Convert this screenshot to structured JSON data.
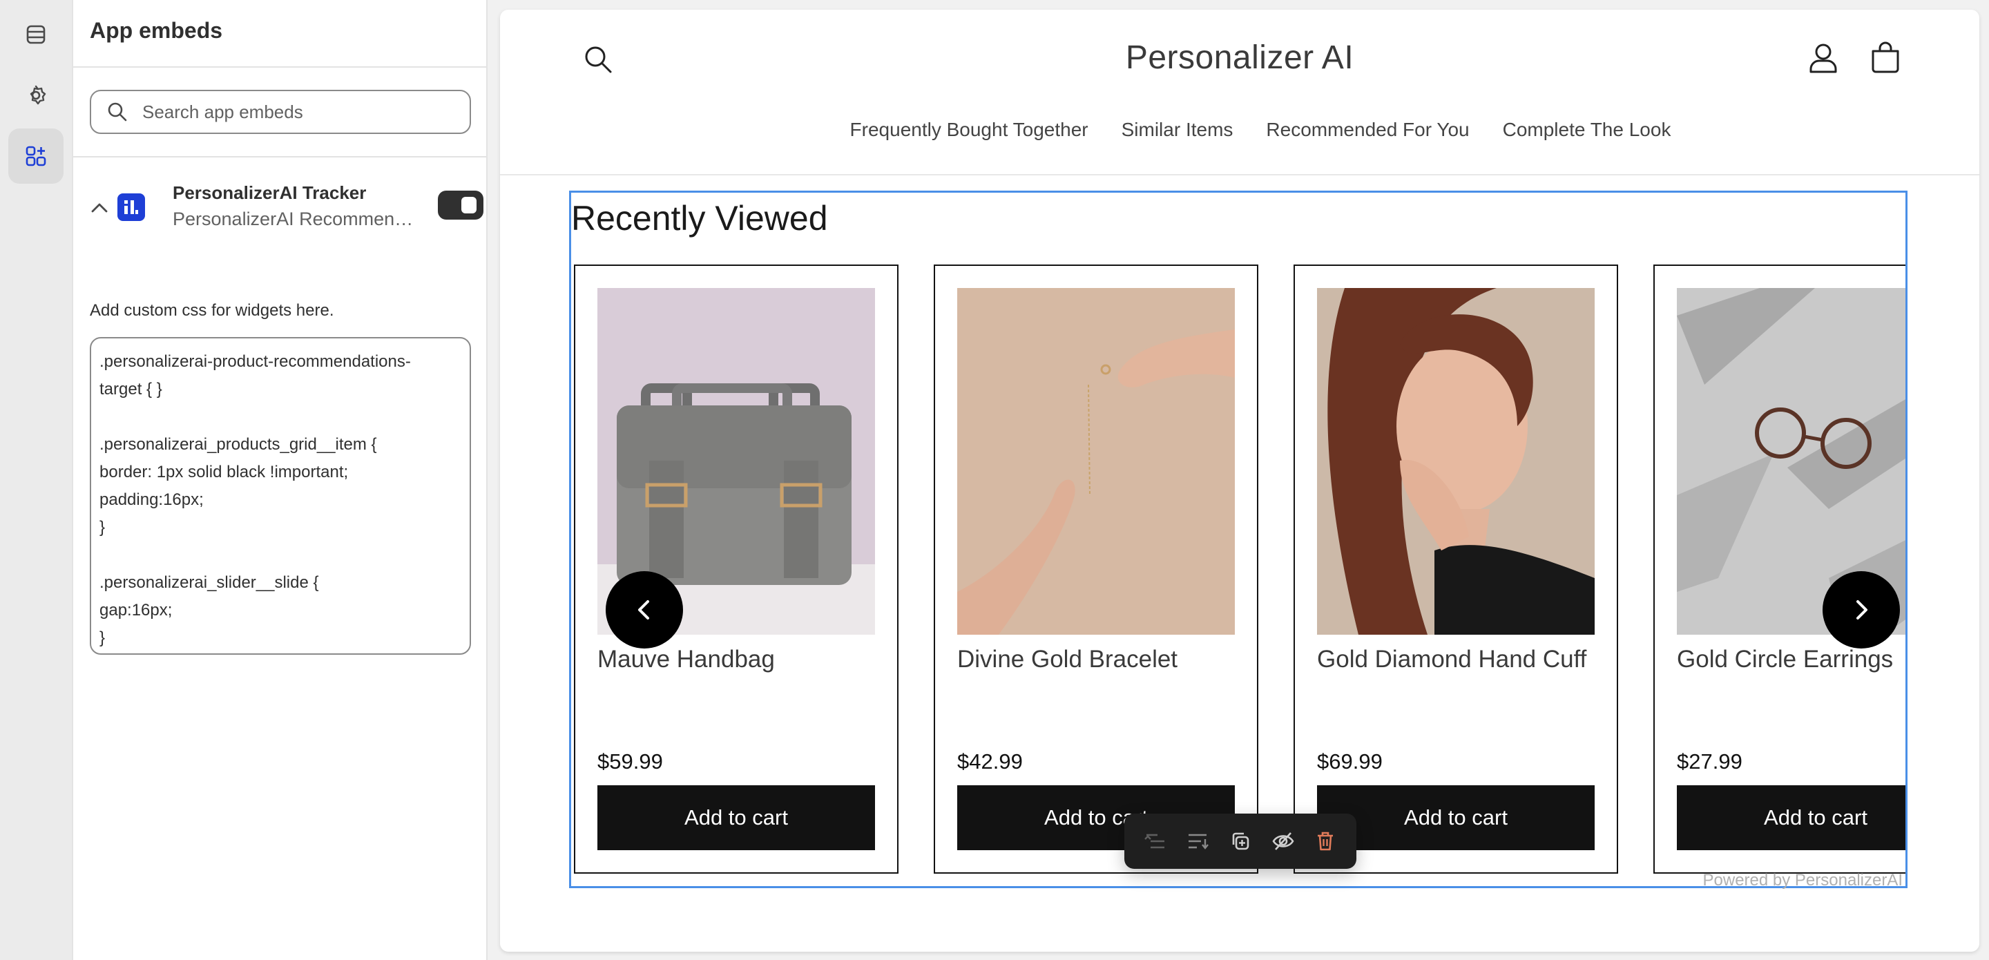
{
  "sidebar": {
    "title": "App embeds",
    "search_placeholder": "Search app embeds",
    "embed": {
      "name": "PersonalizerAI Tracker",
      "subtitle": "PersonalizerAI Recommendations",
      "enabled": true
    },
    "css_label": "Add custom css for widgets here.",
    "css_value": ".personalizerai-product-recommendations-\ntarget { }\n\n.personalizerai_products_grid__item {\nborder: 1px solid black !important;\npadding:16px;\n}\n\n.personalizerai_slider__slide {\ngap:16px;\n}"
  },
  "rail": {
    "items": [
      {
        "icon": "sections-icon"
      },
      {
        "icon": "gear-icon"
      },
      {
        "icon": "app-embeds-icon",
        "active": true
      }
    ]
  },
  "store": {
    "name": "Personalizer AI",
    "nav": [
      "Frequently Bought Together",
      "Similar Items",
      "Recommended For You",
      "Complete The Look"
    ]
  },
  "section": {
    "title": "Recently Viewed",
    "powered_by": "Powered by PersonalizerAI",
    "products": [
      {
        "title": "Mauve Handbag",
        "price": "$59.99",
        "button": "Add to cart"
      },
      {
        "title": "Divine Gold Bracelet",
        "price": "$42.99",
        "button": "Add to cart"
      },
      {
        "title": "Gold Diamond Hand Cuff",
        "price": "$69.99",
        "button": "Add to cart"
      },
      {
        "title": "Gold Circle Earrings",
        "price": "$27.99",
        "button": "Add to cart"
      }
    ]
  },
  "toolbar": {
    "items": [
      "move-up-icon",
      "move-down-icon",
      "duplicate-icon",
      "hide-icon",
      "delete-icon"
    ]
  },
  "colors": {
    "accent_selection": "#4a8fe7",
    "button_dark": "#121212",
    "app_logo": "#1e3fd6",
    "delete": "#e07b5a"
  }
}
